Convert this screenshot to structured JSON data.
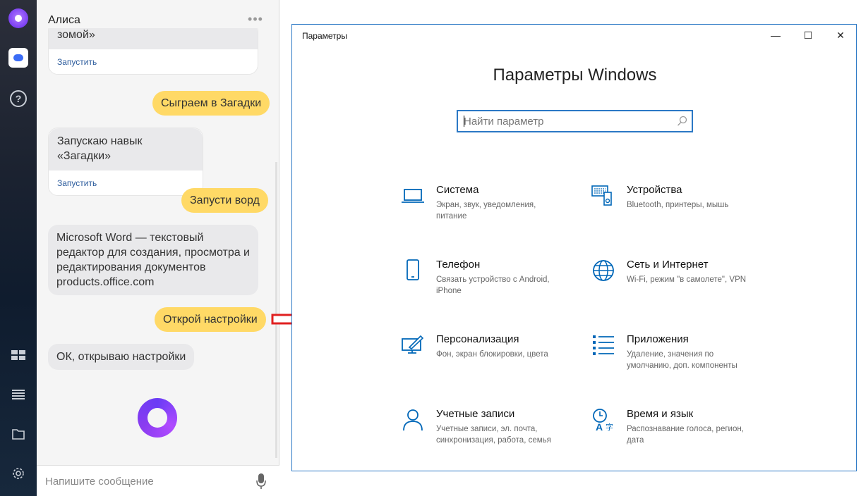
{
  "alice": {
    "title": "Алиса",
    "input_placeholder": "Напишите сообщение",
    "messages": [
      {
        "from": "alice",
        "text": "зомой»",
        "action": "Запустить"
      },
      {
        "from": "user",
        "text": "Сыграем в Загадки"
      },
      {
        "from": "alice",
        "text": "Запускаю навык «Загадки»",
        "action": "Запустить"
      },
      {
        "from": "user",
        "text": "Запусти ворд"
      },
      {
        "from": "alice",
        "text": "Microsoft Word — текстовый редактор для создания, просмотра и редактирования документов products.office.com"
      },
      {
        "from": "user",
        "text": "Открой настройки"
      },
      {
        "from": "alice",
        "text": "ОК, открываю настройки"
      }
    ]
  },
  "settings": {
    "window_title": "Параметры",
    "controls": {
      "minimize": "—",
      "maximize": "☐",
      "close": "✕"
    },
    "heading": "Параметры Windows",
    "search_placeholder": "Найти параметр",
    "accent": "#0067b8",
    "tiles": [
      {
        "icon": "laptop-icon",
        "title": "Система",
        "desc": "Экран, звук, уведомления, питание"
      },
      {
        "icon": "devices-icon",
        "title": "Устройства",
        "desc": "Bluetooth, принтеры, мышь"
      },
      {
        "icon": "phone-icon",
        "title": "Телефон",
        "desc": "Связать устройство с Android, iPhone"
      },
      {
        "icon": "globe-icon",
        "title": "Сеть и Интернет",
        "desc": "Wi-Fi, режим \"в самолете\", VPN"
      },
      {
        "icon": "personalization-icon",
        "title": "Персонализация",
        "desc": "Фон, экран блокировки, цвета"
      },
      {
        "icon": "apps-icon",
        "title": "Приложения",
        "desc": "Удаление, значения по умолчанию, доп. компоненты"
      },
      {
        "icon": "user-icon",
        "title": "Учетные записи",
        "desc": "Учетные записи, эл. почта, синхронизация, работа, семья"
      },
      {
        "icon": "time-language-icon",
        "title": "Время и язык",
        "desc": "Распознавание голоса, регион, дата"
      }
    ]
  },
  "colors": {
    "user_bubble": "#ffd966",
    "alice_bubble": "#e9e9eb",
    "arrow": "#e02020",
    "alice_purple": "#7b3ff2"
  }
}
